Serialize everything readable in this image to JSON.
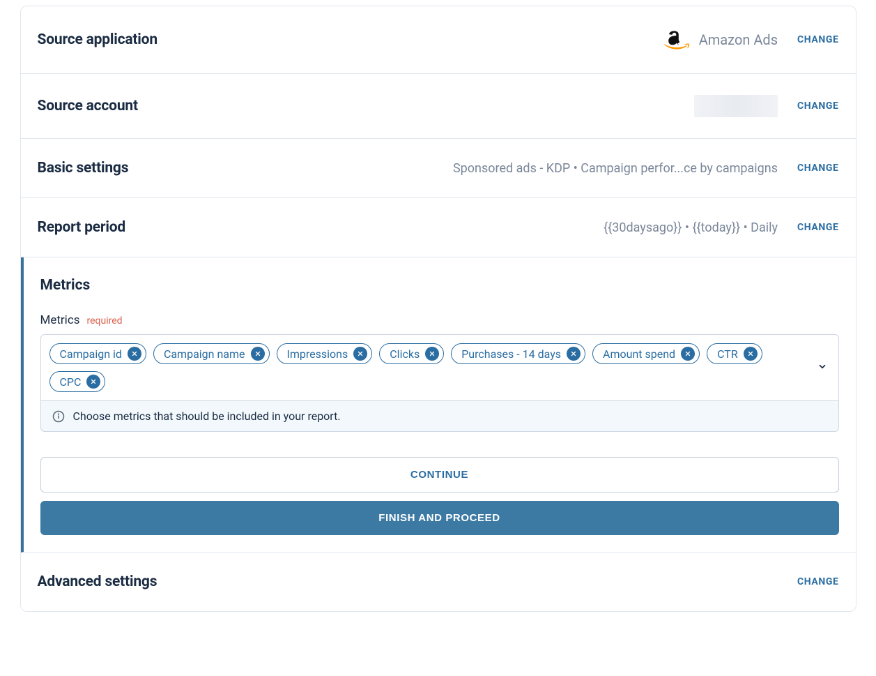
{
  "sections": {
    "source_application": {
      "title": "Source application",
      "name": "Amazon Ads",
      "change": "CHANGE"
    },
    "source_account": {
      "title": "Source account",
      "change": "CHANGE"
    },
    "basic_settings": {
      "title": "Basic settings",
      "summary": "Sponsored ads - KDP • Campaign perfor...ce by campaigns",
      "change": "CHANGE"
    },
    "report_period": {
      "title": "Report period",
      "summary": "{{30daysago}} • {{today}} • Daily",
      "change": "CHANGE"
    },
    "metrics": {
      "title": "Metrics",
      "field_label": "Metrics",
      "required": "required",
      "chips": [
        "Campaign id",
        "Campaign name",
        "Impressions",
        "Clicks",
        "Purchases - 14 days",
        "Amount spend",
        "CTR",
        "CPC"
      ],
      "helper": "Choose metrics that should be included in your report.",
      "continue": "CONTINUE",
      "finish": "FINISH AND PROCEED"
    },
    "advanced_settings": {
      "title": "Advanced settings",
      "change": "CHANGE"
    }
  }
}
